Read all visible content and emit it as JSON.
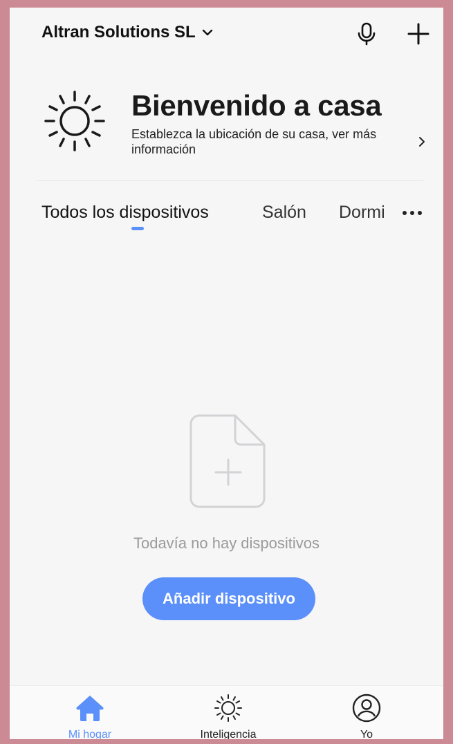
{
  "header": {
    "home_name": "Altran Solutions SL"
  },
  "welcome": {
    "title": "Bienvenido a casa",
    "subtitle": "Establezca la ubicación de su casa, ver más información"
  },
  "tabs": [
    {
      "label": "Todos los dispositivos",
      "active": true
    },
    {
      "label": "Salón",
      "active": false
    },
    {
      "label": "Dormi",
      "active": false
    }
  ],
  "empty_state": {
    "message": "Todavía no hay dispositivos",
    "button_label": "Añadir dispositivo"
  },
  "bottom_nav": [
    {
      "label": "Mi hogar",
      "icon": "home-icon",
      "active": true
    },
    {
      "label": "Inteligencia",
      "icon": "sun-icon",
      "active": false
    },
    {
      "label": "Yo",
      "icon": "profile-icon",
      "active": false
    }
  ],
  "colors": {
    "accent": "#5b8ff9",
    "frame": "#cc8a94",
    "background": "#f6f6f6"
  }
}
